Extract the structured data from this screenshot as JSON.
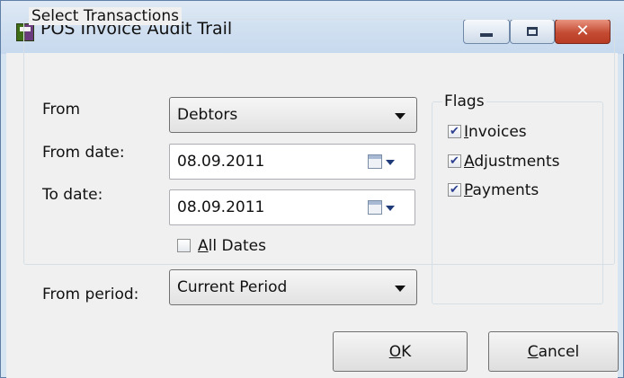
{
  "window": {
    "title": "POS Invoice Audit Trail"
  },
  "select_group": {
    "legend": "Select Transactions",
    "from_label": "From",
    "from_value": "Debtors",
    "from_date_label": "From date:",
    "from_date_value": "08.09.2011",
    "to_date_label": "To date:",
    "to_date_value": "08.09.2011",
    "all_dates_label": "All Dates",
    "all_dates_mnemonic": "A",
    "all_dates_rest": "ll Dates",
    "all_dates_checked": false,
    "from_period_label": "From period:",
    "from_period_value": "Current Period"
  },
  "flags": {
    "legend": "Flags",
    "items": [
      {
        "label": "Invoices",
        "mnemonic": "I",
        "rest": "nvoices",
        "checked": true
      },
      {
        "label": "Adjustments",
        "mnemonic": "A",
        "rest": "djustments",
        "checked": true
      },
      {
        "label": "Payments",
        "mnemonic": "P",
        "rest": "ayments",
        "checked": true
      }
    ]
  },
  "buttons": {
    "ok": {
      "label": "OK",
      "mnemonic": "O",
      "rest": "K"
    },
    "cancel": {
      "label": "Cancel",
      "mnemonic": "C",
      "rest": "ancel"
    }
  },
  "icons": {
    "app": "app-icon",
    "minimize": "minimize-icon",
    "maximize": "maximize-icon",
    "close": "close-icon",
    "calendar": "calendar-icon",
    "dropdown": "chevron-down-icon",
    "check": "checkmark-icon"
  },
  "colors": {
    "titlebar": "#d2e1f1",
    "close_button": "#c44c34",
    "client_background": "#f0f0f0"
  }
}
